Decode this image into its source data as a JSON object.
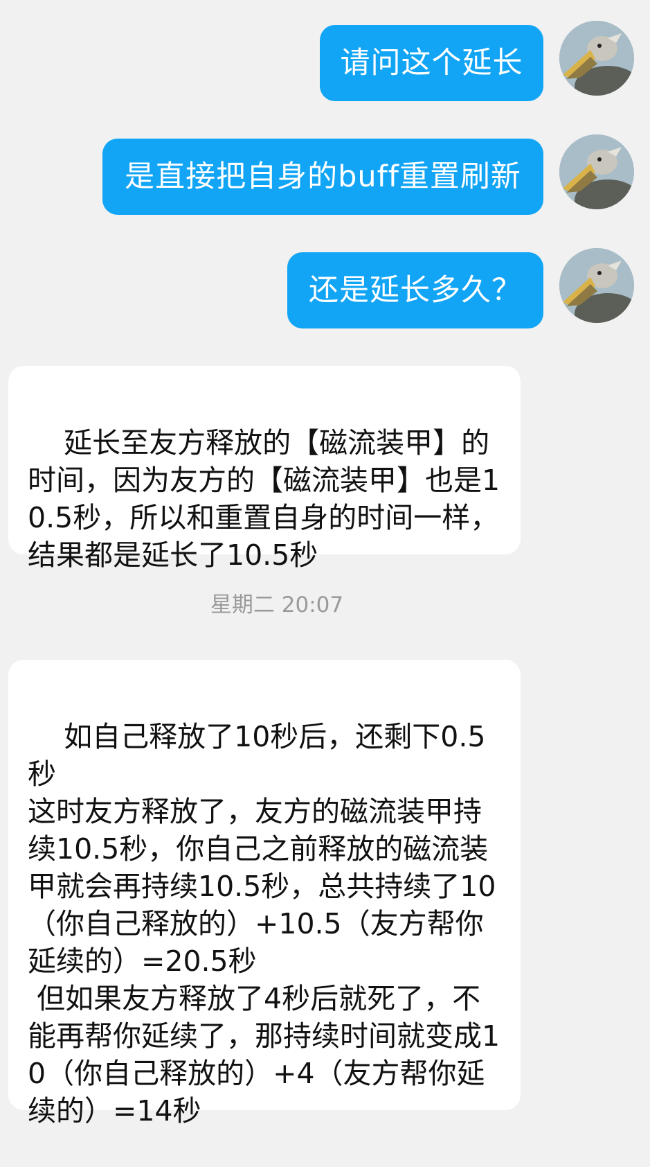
{
  "messages_out": [
    {
      "text": "请问这个延长"
    },
    {
      "text": "是直接把自身的buff重置刷新"
    },
    {
      "text": "还是延长多久？"
    }
  ],
  "messages_in": [
    {
      "text": "延长至友方释放的【磁流装甲】的时间，因为友方的【磁流装甲】也是10.5秒，所以和重置自身的时间一样，结果都是延长了10.5秒"
    },
    {
      "text": "如自己释放了10秒后，还剩下0.5秒\n这时友方释放了，友方的磁流装甲持续10.5秒，你自己之前释放的磁流装甲就会再持续10.5秒，总共持续了10（你自己释放的）+10.5（友方帮你延续的）=20.5秒\n 但如果友方释放了4秒后就死了，不能再帮你延续了，那持续时间就变成10（你自己释放的）+4（友方帮你延续的）=14秒"
    }
  ],
  "timestamp": "星期二 20:07",
  "avatar_icon": "pelican-avatar-icon",
  "colors": {
    "background": "#f1f1f1",
    "outgoing_bubble": "#12a5f5",
    "incoming_bubble": "#ffffff",
    "timestamp_text": "#9a9a9a"
  }
}
